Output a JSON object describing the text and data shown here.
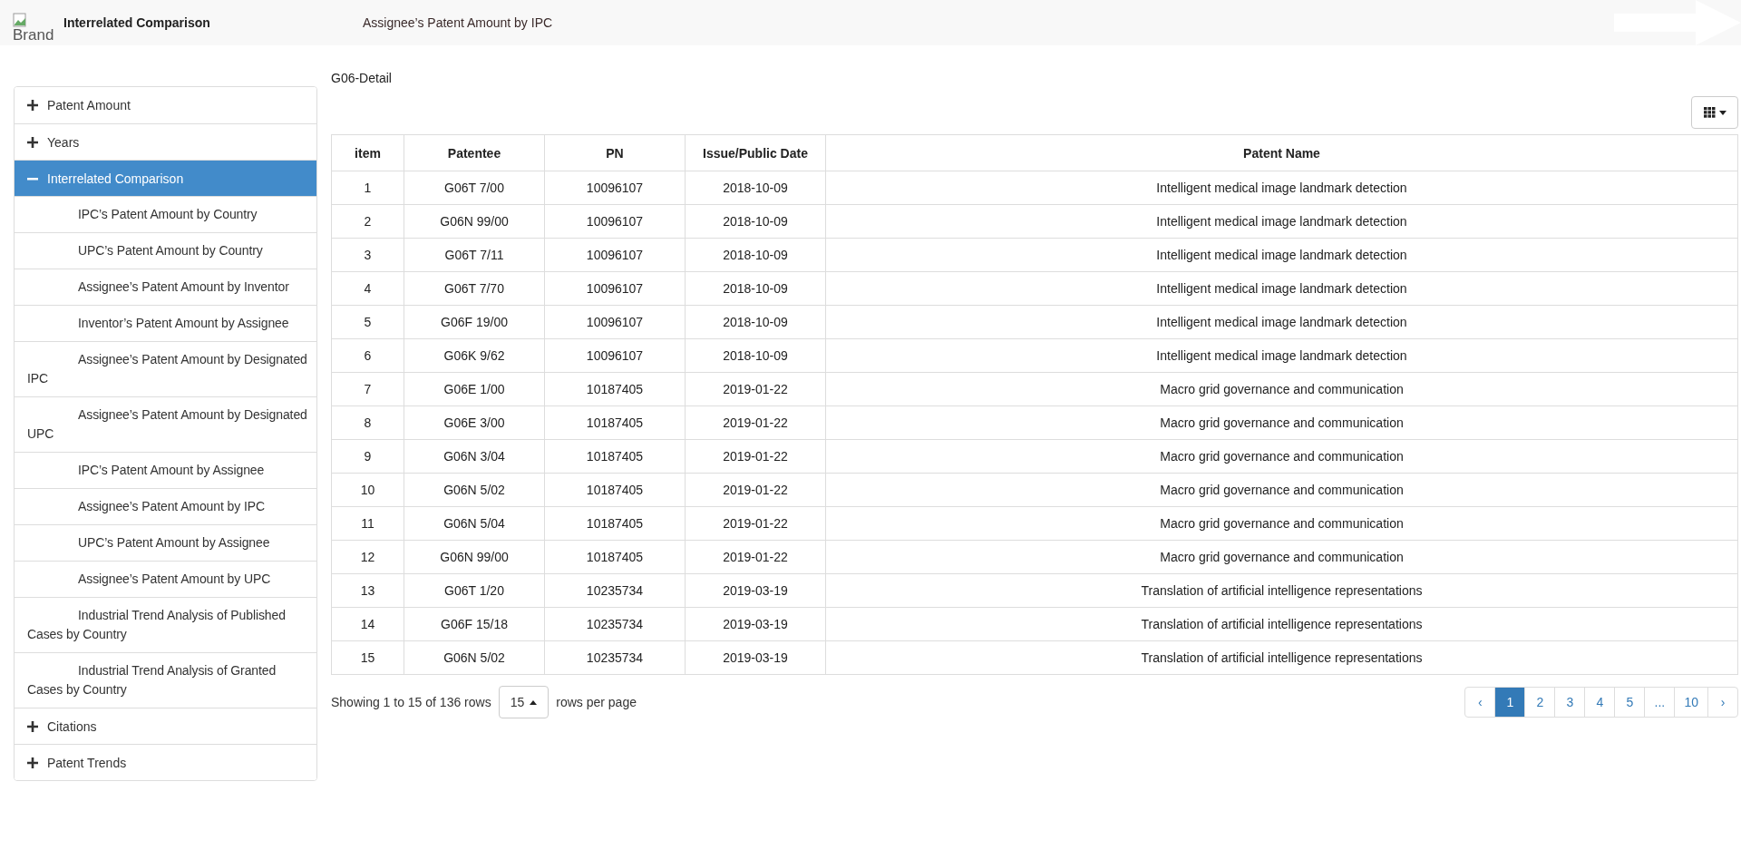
{
  "header": {
    "brand_alt": "Brand",
    "title": "Interrelated Comparison",
    "subtitle": "Assignee’s Patent Amount by IPC"
  },
  "sidebar": {
    "items": [
      {
        "label": "Patent Amount",
        "expanded": false,
        "selected": false
      },
      {
        "label": "Years",
        "expanded": false,
        "selected": false
      },
      {
        "label": "Interrelated Comparison",
        "expanded": true,
        "selected": true,
        "children": [
          {
            "label": "IPC’s Patent Amount by Country"
          },
          {
            "label": "UPC’s Patent Amount by Country"
          },
          {
            "label": "Assignee’s Patent Amount by Inventor"
          },
          {
            "label": "Inventor’s Patent Amount by Assignee"
          },
          {
            "label": "Assignee’s Patent Amount by Designated IPC"
          },
          {
            "label": "Assignee’s Patent Amount by Designated UPC"
          },
          {
            "label": "IPC’s Patent Amount by Assignee"
          },
          {
            "label": "Assignee’s Patent Amount by IPC"
          },
          {
            "label": "UPC’s Patent Amount by Assignee"
          },
          {
            "label": "Assignee’s Patent Amount by UPC"
          },
          {
            "label": "Industrial Trend Analysis of Published Cases by Country"
          },
          {
            "label": "Industrial Trend Analysis of Granted Cases by Country"
          }
        ]
      },
      {
        "label": "Citations",
        "expanded": false,
        "selected": false
      },
      {
        "label": "Patent Trends",
        "expanded": false,
        "selected": false
      }
    ]
  },
  "detail_title": "G06-Detail",
  "table": {
    "columns": [
      "item",
      "Patentee",
      "PN",
      "Issue/Public Date",
      "Patent Name"
    ],
    "rows": [
      [
        "1",
        "G06T 7/00",
        "10096107",
        "2018-10-09",
        "Intelligent medical image landmark detection"
      ],
      [
        "2",
        "G06N 99/00",
        "10096107",
        "2018-10-09",
        "Intelligent medical image landmark detection"
      ],
      [
        "3",
        "G06T 7/11",
        "10096107",
        "2018-10-09",
        "Intelligent medical image landmark detection"
      ],
      [
        "4",
        "G06T 7/70",
        "10096107",
        "2018-10-09",
        "Intelligent medical image landmark detection"
      ],
      [
        "5",
        "G06F 19/00",
        "10096107",
        "2018-10-09",
        "Intelligent medical image landmark detection"
      ],
      [
        "6",
        "G06K 9/62",
        "10096107",
        "2018-10-09",
        "Intelligent medical image landmark detection"
      ],
      [
        "7",
        "G06E 1/00",
        "10187405",
        "2019-01-22",
        "Macro grid governance and communication"
      ],
      [
        "8",
        "G06E 3/00",
        "10187405",
        "2019-01-22",
        "Macro grid governance and communication"
      ],
      [
        "9",
        "G06N 3/04",
        "10187405",
        "2019-01-22",
        "Macro grid governance and communication"
      ],
      [
        "10",
        "G06N 5/02",
        "10187405",
        "2019-01-22",
        "Macro grid governance and communication"
      ],
      [
        "11",
        "G06N 5/04",
        "10187405",
        "2019-01-22",
        "Macro grid governance and communication"
      ],
      [
        "12",
        "G06N 99/00",
        "10187405",
        "2019-01-22",
        "Macro grid governance and communication"
      ],
      [
        "13",
        "G06T 1/20",
        "10235734",
        "2019-03-19",
        "Translation of artificial intelligence representations"
      ],
      [
        "14",
        "G06F 15/18",
        "10235734",
        "2019-03-19",
        "Translation of artificial intelligence representations"
      ],
      [
        "15",
        "G06N 5/02",
        "10235734",
        "2019-03-19",
        "Translation of artificial intelligence representations"
      ]
    ]
  },
  "footer": {
    "showing": "Showing 1 to 15 of 136 rows",
    "page_size": "15",
    "per_page": "rows per page"
  },
  "pagination": [
    {
      "label": "‹",
      "selected": false
    },
    {
      "label": "1",
      "selected": true
    },
    {
      "label": "2",
      "selected": false
    },
    {
      "label": "3",
      "selected": false
    },
    {
      "label": "4",
      "selected": false
    },
    {
      "label": "5",
      "selected": false
    },
    {
      "label": "...",
      "selected": false
    },
    {
      "label": "10",
      "selected": false
    },
    {
      "label": "›",
      "selected": false
    }
  ]
}
